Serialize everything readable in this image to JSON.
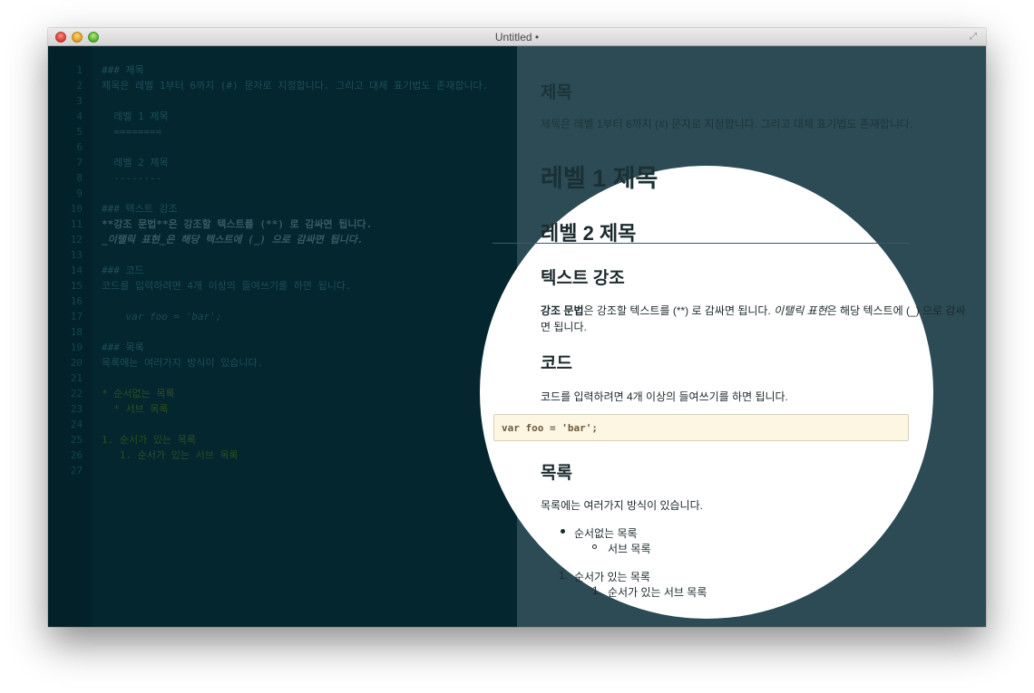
{
  "window": {
    "title": "Untitled •"
  },
  "editor": {
    "lines": [
      {
        "n": "1",
        "t": "### 제목"
      },
      {
        "n": "2",
        "t": "제목은 레벨 1부터 6까지 (#) 문자로 지정합니다. 그리고 대체 표기법도 존재합니다."
      },
      {
        "n": "3",
        "t": ""
      },
      {
        "n": "4",
        "t": "  레벨 1 제목"
      },
      {
        "n": "5",
        "t": "  ========"
      },
      {
        "n": "6",
        "t": ""
      },
      {
        "n": "7",
        "t": "  레벨 2 제목"
      },
      {
        "n": "8",
        "t": "  --------"
      },
      {
        "n": "9",
        "t": ""
      },
      {
        "n": "10",
        "t": "### 텍스트 강조"
      },
      {
        "n": "11",
        "t": "**강조 문법**은 강조할 텍스트를 (**) 로 감싸면 됩니다."
      },
      {
        "n": "12",
        "t": "_이탤릭 표현_은 해당 텍스트에 (_) 으로 감싸면 됩니다."
      },
      {
        "n": "13",
        "t": ""
      },
      {
        "n": "14",
        "t": "### 코드"
      },
      {
        "n": "15",
        "t": "코드를 입력하려면 4개 이상의 들여쓰기를 하면 됩니다."
      },
      {
        "n": "16",
        "t": ""
      },
      {
        "n": "17",
        "t": "    var foo = 'bar';"
      },
      {
        "n": "18",
        "t": ""
      },
      {
        "n": "19",
        "t": "### 목록"
      },
      {
        "n": "20",
        "t": "목록에는 여러가지 방식이 있습니다."
      },
      {
        "n": "21",
        "t": ""
      },
      {
        "n": "22",
        "t": "* 순서없는 목록"
      },
      {
        "n": "23",
        "t": "  * 서브 목록"
      },
      {
        "n": "24",
        "t": ""
      },
      {
        "n": "25",
        "t": "1. 순서가 있는 목록"
      },
      {
        "n": "26",
        "t": "   1. 순서가 있는 서브 목록"
      },
      {
        "n": "27",
        "t": ""
      }
    ]
  },
  "preview": {
    "h_title": "제목",
    "p_title": "제목은 레벨 1부터 6까지 (#) 문자로 지정합니다. 그리고 대체 표기법도 존재합니다.",
    "h1": "레벨 1 제목",
    "h2": "레벨 2 제목",
    "h_emph": "텍스트 강조",
    "p_emph_bold": "강조 문법",
    "p_emph_1": "은 강조할 텍스트를 (**) 로 감싸면 됩니다. ",
    "p_emph_italic": "이탤릭 표현",
    "p_emph_2": "은 해당 텍스트에 (_) 으로 감싸",
    "p_emph_3": "면 됩니다.",
    "h_code": "코드",
    "p_code": "코드를 입력하려면 4개 이상의 들여쓰기를 하면 됩니다.",
    "code": "var foo = 'bar';",
    "h_list": "목록",
    "p_list": "목록에는 여러가지 방식이 있습니다.",
    "ul_item": "순서없는 목록",
    "ul_sub": "서브 목록",
    "ol_num": "1.",
    "ol_item": "순서가 있는 목록",
    "ol_sub_num": "1.",
    "ol_sub": "순서가 있는 서브 목록"
  }
}
